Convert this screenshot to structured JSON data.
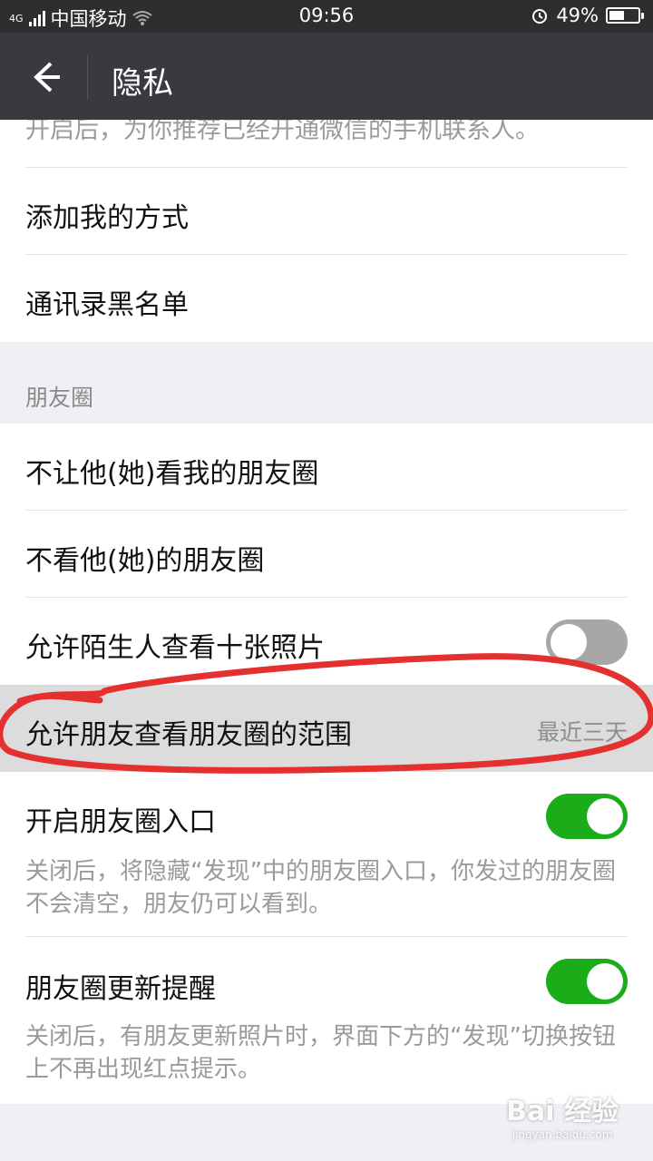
{
  "status_bar": {
    "network": "4G",
    "carrier": "中国移动",
    "time": "09:56",
    "battery": "49%",
    "battery_level": 0.49
  },
  "header": {
    "title": "隐私"
  },
  "contacts_section": {
    "recommend_desc": "开启后，为你推荐已经开通微信的手机联系人。",
    "add_me_ways": "添加我的方式",
    "contacts_blacklist": "通讯录黑名单"
  },
  "moments_section": {
    "header": "朋友圈",
    "items": {
      "hide_my_moments": "不让他(她)看我的朋友圈",
      "dont_see_their": "不看他(她)的朋友圈",
      "strangers_ten_photos": {
        "label": "允许陌生人查看十张照片",
        "enabled": false
      },
      "view_range": {
        "label": "允许朋友查看朋友圈的范围",
        "value": "最近三天"
      },
      "moments_entry": {
        "label": "开启朋友圈入口",
        "enabled": true,
        "desc": "关闭后，将隐藏“发现”中的朋友圈入口，你发过的朋友圈不会清空，朋友仍可以看到。"
      },
      "moments_update_alert": {
        "label": "朋友圈更新提醒",
        "enabled": true,
        "desc": "关闭后，有朋友更新照片时，界面下方的“发现”切换按钮上不再出现红点提示。"
      }
    }
  },
  "watermark": {
    "text": "Bai 经验",
    "sub": "jingyan.baidu.com"
  },
  "colors": {
    "toggle_on": "#1aad19",
    "toggle_off": "#a7a7a7",
    "annotation": "#e53030",
    "topbar": "#393a3f"
  }
}
